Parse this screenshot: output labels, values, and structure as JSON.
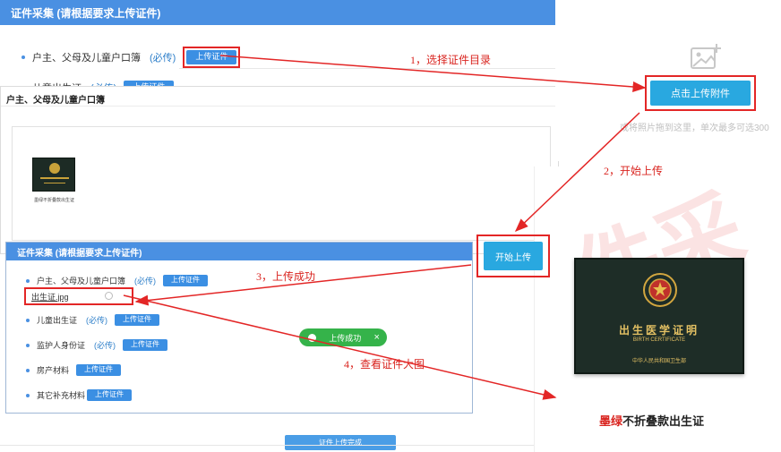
{
  "panel_top": {
    "title": "证件采集 (请根据要求上传证件)",
    "row1": {
      "label": "户主、父母及儿童户口簿",
      "req": "(必传)",
      "button": "上传证件"
    },
    "row2": {
      "label": "儿童出生证",
      "req": "(必传)",
      "button": "上传证件"
    }
  },
  "modal": {
    "title": "户主、父母及儿童户口簿",
    "thumb_caption": "墨绿不折叠款出生证"
  },
  "upload_panel": {
    "upload_button": "点击上传附件",
    "hint": "或将照片拖到这里，单次最多可选300"
  },
  "start_upload": {
    "label": "开始上传"
  },
  "preview": {
    "cert_title": "出生医学证明",
    "cert_subtitle": "BIRTH CERTIFICATE",
    "cert_issuer": "中华人民共和国卫生部",
    "caption_colored": "墨绿",
    "caption_rest": "不折叠款出生证",
    "watermark": "件采"
  },
  "panel_success": {
    "title": "证件采集 (请根据要求上传证件)",
    "row1": {
      "label": "户主、父母及儿童户口簿",
      "req": "(必传)",
      "button": "上传证件"
    },
    "uploaded_file": "出生证.jpg",
    "row2": {
      "label": "儿童出生证",
      "req": "(必传)",
      "button": "上传证件"
    },
    "row3": {
      "label": "监护人身份证",
      "req": "(必传)",
      "button": "上传证件"
    },
    "row4": {
      "label": "房产材料",
      "button": "上传证件"
    },
    "row5": {
      "label": "其它补充材料",
      "button": "上传证件"
    },
    "submit": "证件上传完成"
  },
  "toast": {
    "text": "上传成功",
    "close": "×"
  },
  "annotations": {
    "step1": "1，选择证件目录",
    "step2": "2，开始上传",
    "step3": "3，上传成功",
    "step4": "4，查看证件大图"
  },
  "colors": {
    "accent": "#4a90e2",
    "annotation": "#e32626",
    "success": "#35b34a",
    "cert": "#1d2b25"
  }
}
